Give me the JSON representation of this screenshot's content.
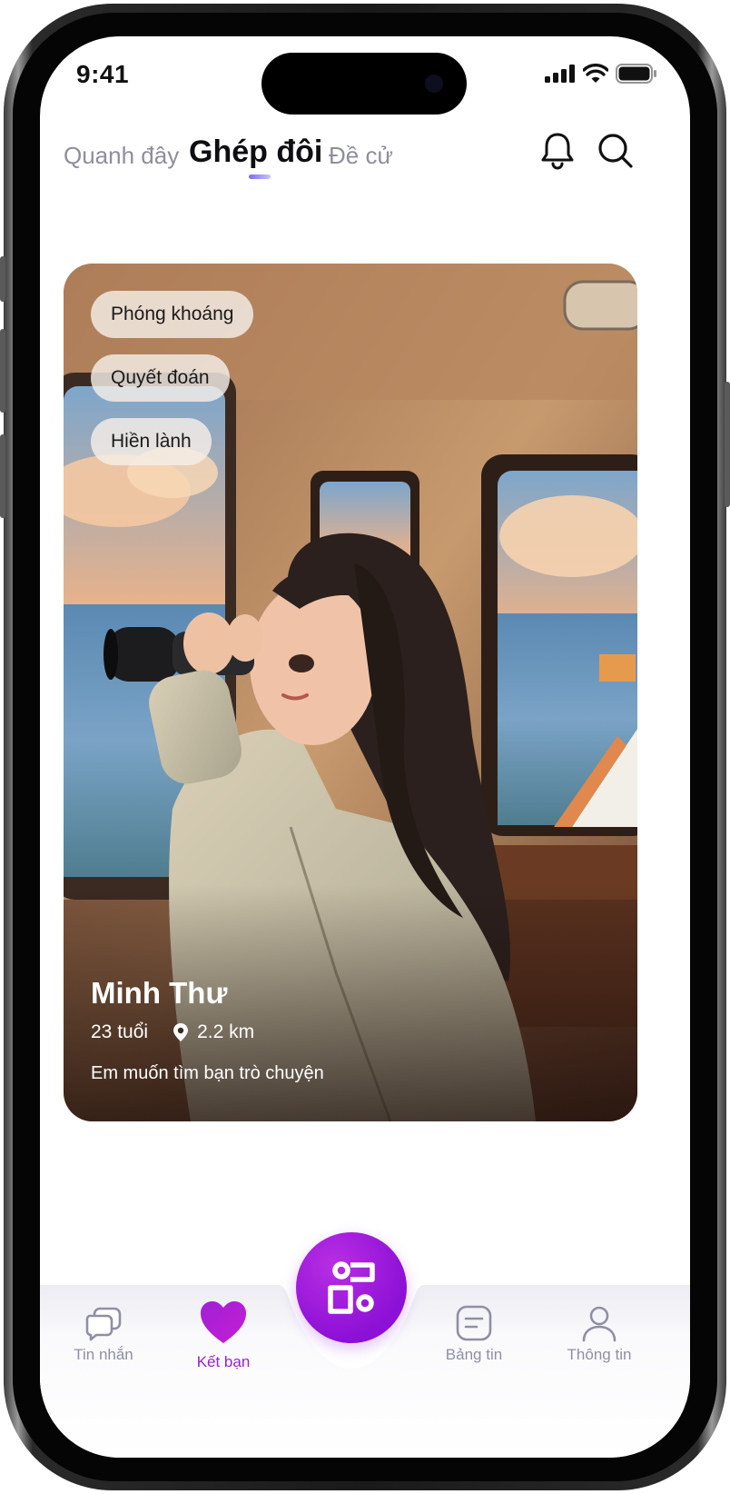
{
  "status_bar": {
    "time": "9:41"
  },
  "header": {
    "tabs": [
      {
        "label": "Quanh đây",
        "active": false
      },
      {
        "label": "Ghép đôi",
        "active": true
      },
      {
        "label": "Đề cử",
        "active": false
      }
    ],
    "icons": [
      "bell-icon",
      "search-icon"
    ]
  },
  "profile_card": {
    "tags": [
      "Phóng khoáng",
      "Quyết đoán",
      "Hiền lành"
    ],
    "name": "Minh Thư",
    "age": "23 tuổi",
    "distance": "2.2 km",
    "bio": "Em muốn tìm bạn trò chuyện"
  },
  "bottom_nav": {
    "items": [
      {
        "label": "Tin nhắn",
        "icon": "chat-icon",
        "active": false
      },
      {
        "label": "Kết bạn",
        "icon": "heart-icon",
        "active": true
      },
      {
        "label": "Bảng tin",
        "icon": "feed-icon",
        "active": false
      },
      {
        "label": "Thông tin",
        "icon": "user-icon",
        "active": false
      }
    ],
    "center_action_icon": "match-icon"
  },
  "colors": {
    "accent": "#9a1fd1",
    "inactive": "#8f8fa4",
    "tab_underline": "#7a6cf5"
  }
}
